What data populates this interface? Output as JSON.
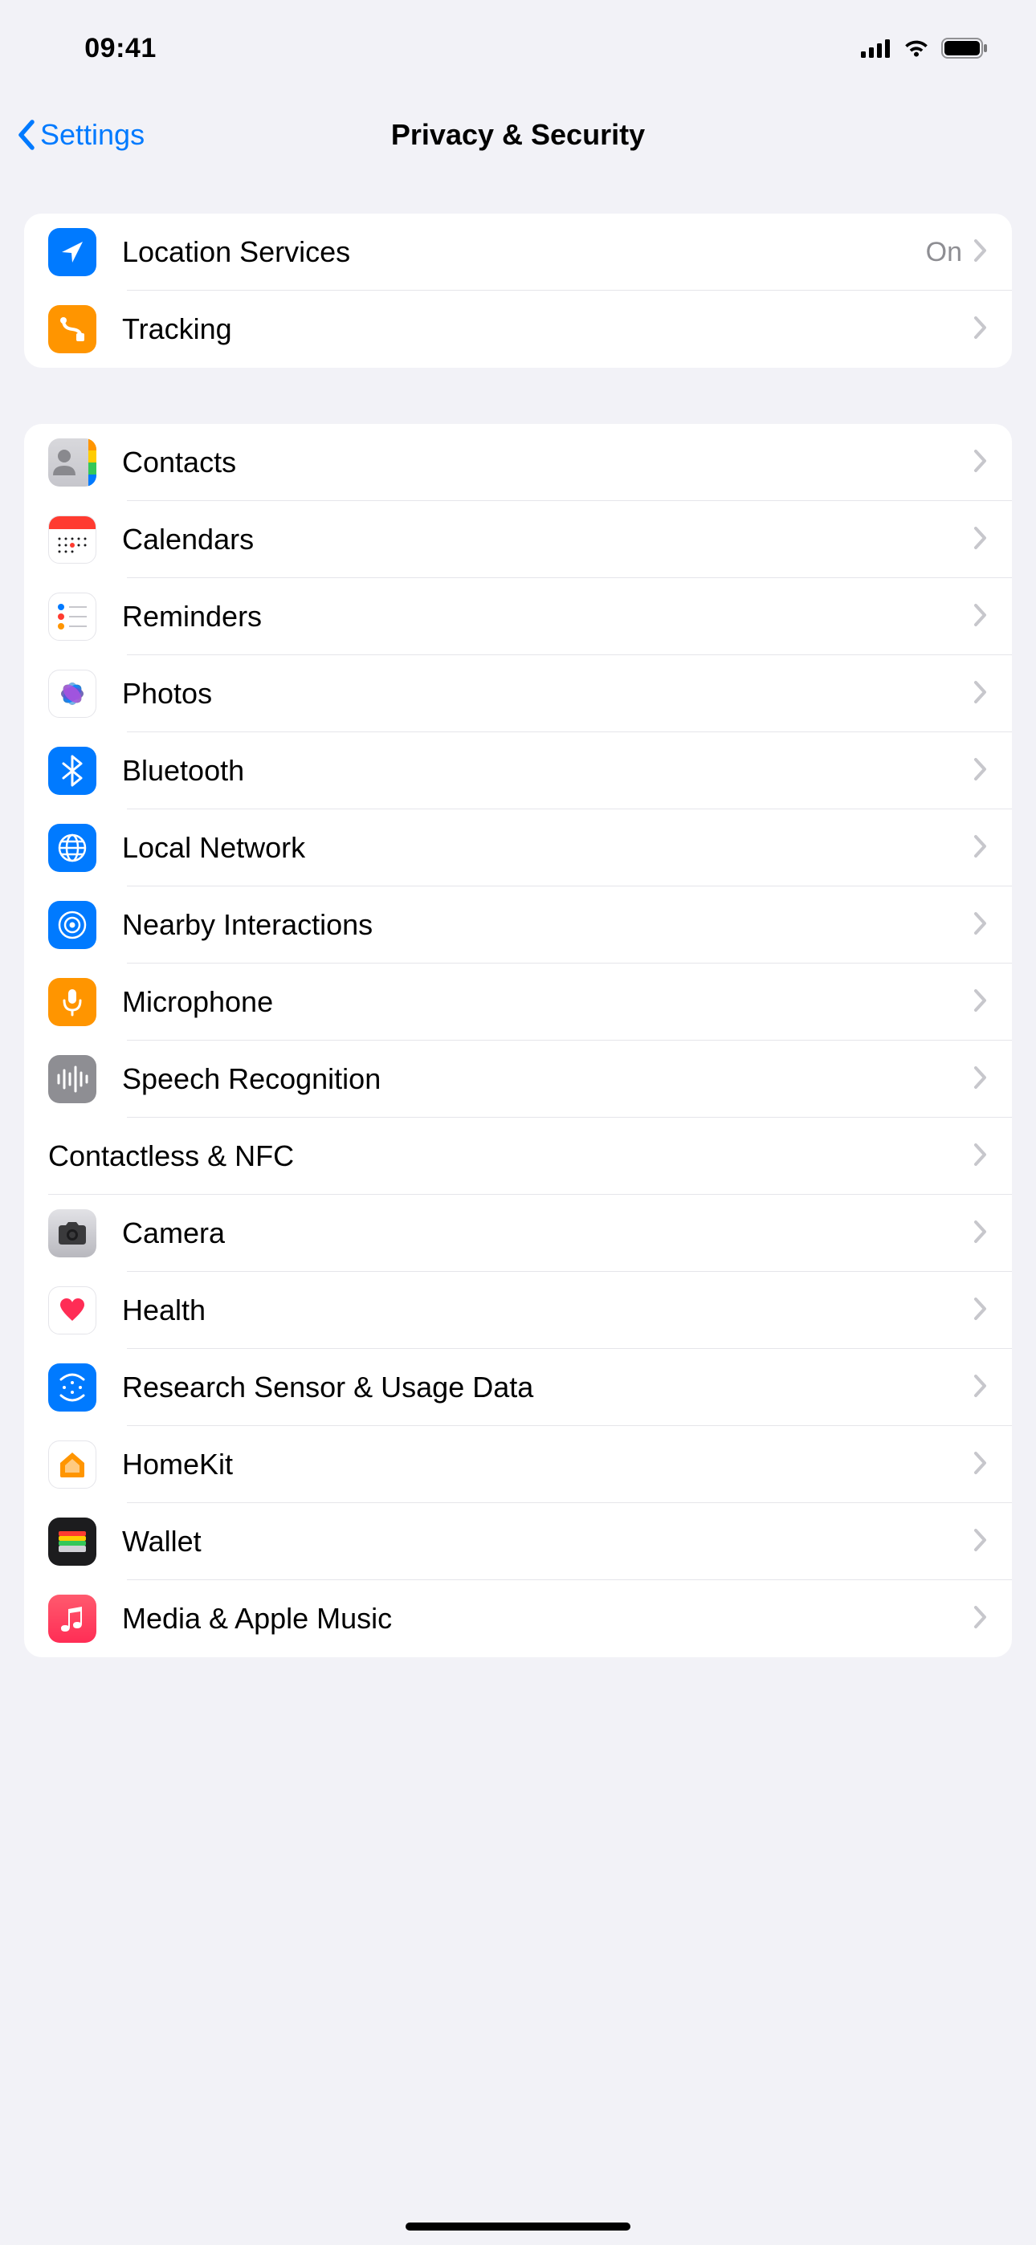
{
  "status": {
    "time": "09:41"
  },
  "nav": {
    "back_label": "Settings",
    "title": "Privacy & Security"
  },
  "group1": {
    "location": {
      "label": "Location Services",
      "value": "On"
    },
    "tracking": {
      "label": "Tracking"
    }
  },
  "group2": {
    "contacts": {
      "label": "Contacts"
    },
    "calendars": {
      "label": "Calendars"
    },
    "reminders": {
      "label": "Reminders"
    },
    "photos": {
      "label": "Photos"
    },
    "bluetooth": {
      "label": "Bluetooth"
    },
    "localnetwork": {
      "label": "Local Network"
    },
    "nearby": {
      "label": "Nearby Interactions"
    },
    "microphone": {
      "label": "Microphone"
    },
    "speech": {
      "label": "Speech Recognition"
    },
    "contactless": {
      "label": "Contactless & NFC"
    },
    "camera": {
      "label": "Camera"
    },
    "health": {
      "label": "Health"
    },
    "research": {
      "label": "Research Sensor & Usage Data"
    },
    "homekit": {
      "label": "HomeKit"
    },
    "wallet": {
      "label": "Wallet"
    },
    "media": {
      "label": "Media & Apple Music"
    }
  }
}
